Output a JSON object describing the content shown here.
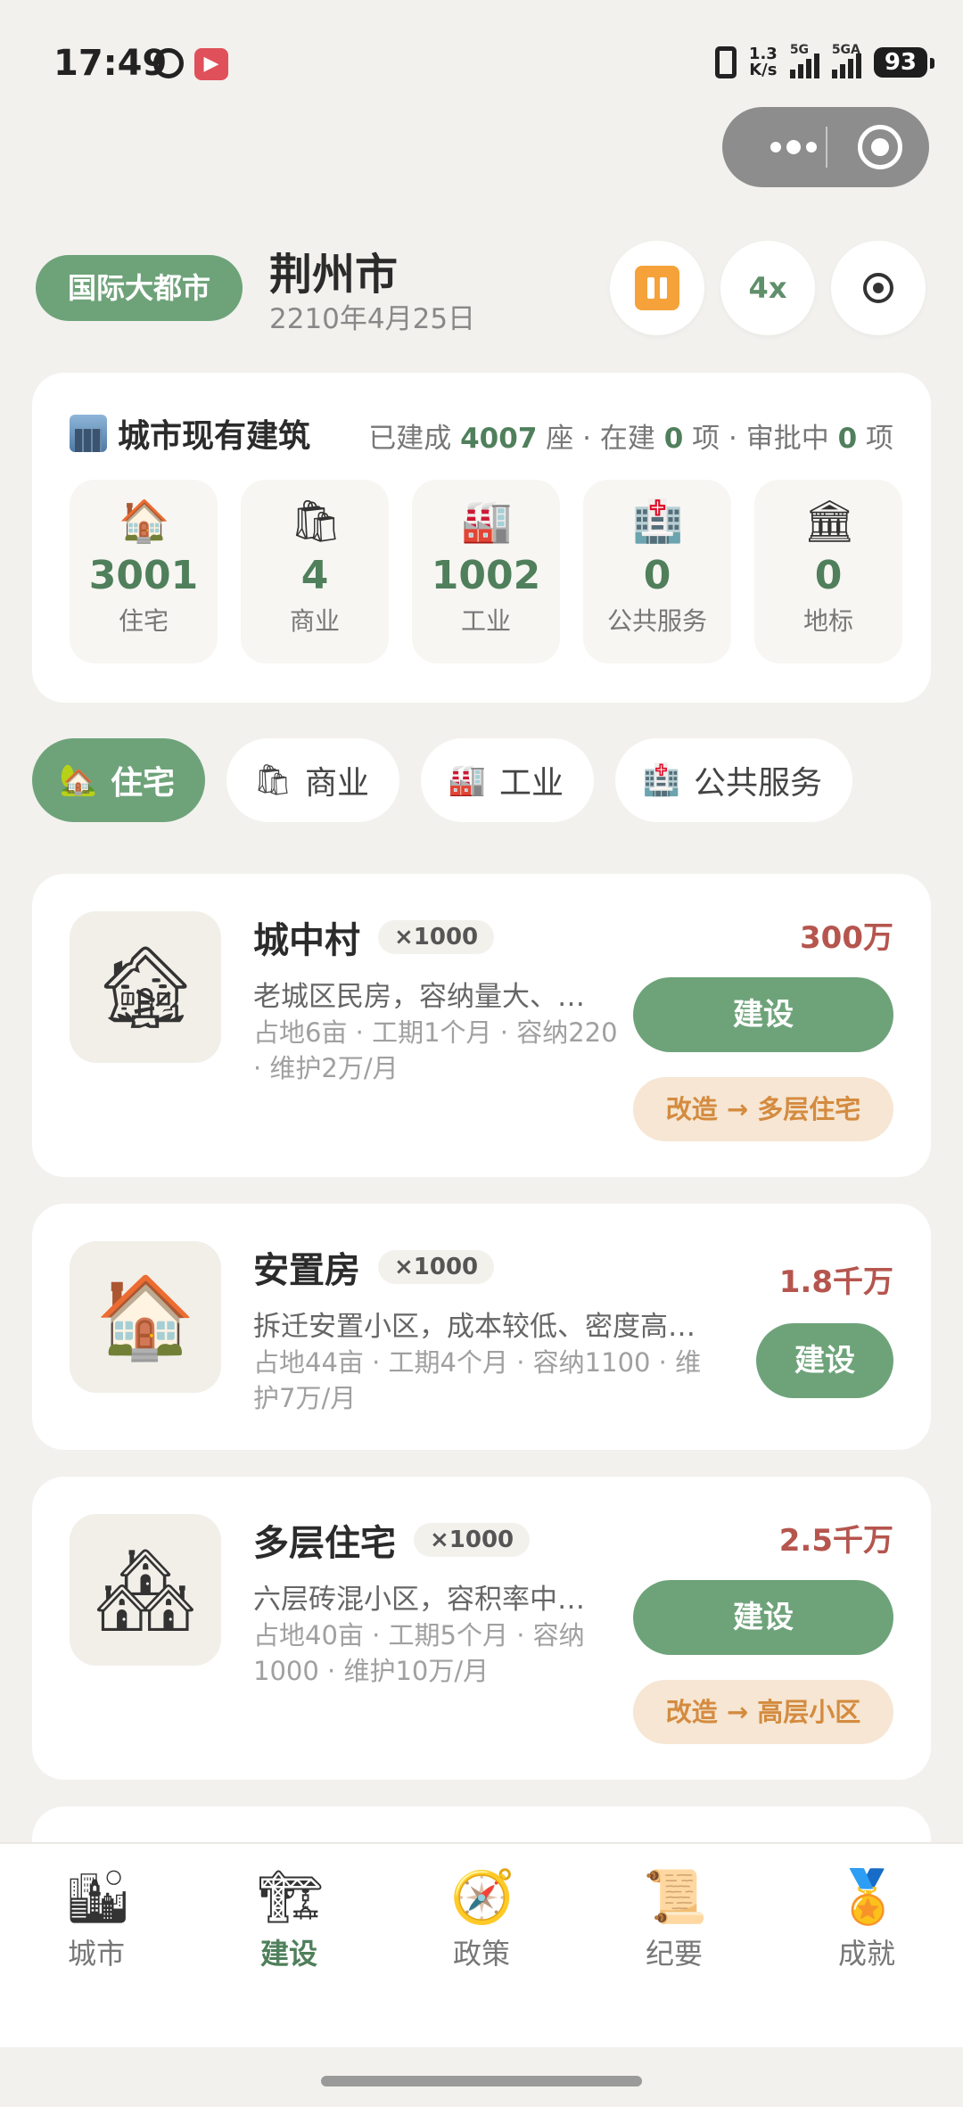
{
  "status_bar": {
    "time": "17:49",
    "net_speed_top": "1.3",
    "net_speed_bottom": "K/s",
    "sim1": "5G",
    "sim2": "5GA",
    "battery": "93"
  },
  "header": {
    "rank": "国际大都市",
    "city_name": "荆州市",
    "date": "2210年4月25日",
    "speed": "4x"
  },
  "summary": {
    "title": "城市现有建筑",
    "built_prefix": "已建成",
    "built_count": "4007",
    "built_unit": "座",
    "sep1": "·",
    "in_progress_prefix": "在建",
    "in_progress_count": "0",
    "in_progress_unit": "项",
    "sep2": "·",
    "approval_prefix": "审批中",
    "approval_count": "0",
    "approval_unit": "项",
    "tiles": [
      {
        "icon": "house-icon",
        "value": "3001",
        "label": "住宅"
      },
      {
        "icon": "shopping-bags-icon",
        "value": "4",
        "label": "商业"
      },
      {
        "icon": "factory-icon",
        "value": "1002",
        "label": "工业"
      },
      {
        "icon": "hospital-icon",
        "value": "0",
        "label": "公共服务"
      },
      {
        "icon": "landmark-icon",
        "value": "0",
        "label": "地标"
      }
    ]
  },
  "tabs": [
    {
      "label": "住宅",
      "icon": "house-garden-icon",
      "active": true
    },
    {
      "label": "商业",
      "icon": "shopping-bags-icon"
    },
    {
      "label": "工业",
      "icon": "factory-icon"
    },
    {
      "label": "公共服务",
      "icon": "hospital-icon"
    }
  ],
  "buildings": [
    {
      "name": "城中村",
      "multiplier": "×1000",
      "desc": "老城区民房，容纳量大、…",
      "meta": "占地6亩 · 工期1个月 · 容纳220 · 维护2万/月",
      "price": "300万",
      "build_label": "建设",
      "upgrade_label": "改造 → 多层住宅",
      "icon": "derelict-house-icon"
    },
    {
      "name": "安置房",
      "multiplier": "×1000",
      "desc": "拆迁安置小区，成本较低、密度高…",
      "meta": "占地44亩 · 工期4个月 · 容纳1100 · 维护7万/月",
      "price": "1.8千万",
      "build_label": "建设",
      "icon": "house-icon"
    },
    {
      "name": "多层住宅",
      "multiplier": "×1000",
      "desc": "六层砖混小区，容积率中…",
      "meta": "占地40亩 · 工期5个月 · 容纳1000 · 维护10万/月",
      "price": "2.5千万",
      "build_label": "建设",
      "upgrade_label": "改造 → 高层小区",
      "icon": "houses-icon"
    }
  ],
  "bottom_nav": [
    {
      "label": "城市",
      "icon": "cityscape-icon"
    },
    {
      "label": "建设",
      "icon": "crane-icon",
      "active": true
    },
    {
      "label": "政策",
      "icon": "compass-icon"
    },
    {
      "label": "纪要",
      "icon": "scroll-icon"
    },
    {
      "label": "成就",
      "icon": "medal-icon"
    }
  ],
  "colors": {
    "accent": "#6ea37a",
    "price": "#b5554e",
    "upgrade_text": "#d48b3f",
    "background": "#f2f1ee"
  }
}
